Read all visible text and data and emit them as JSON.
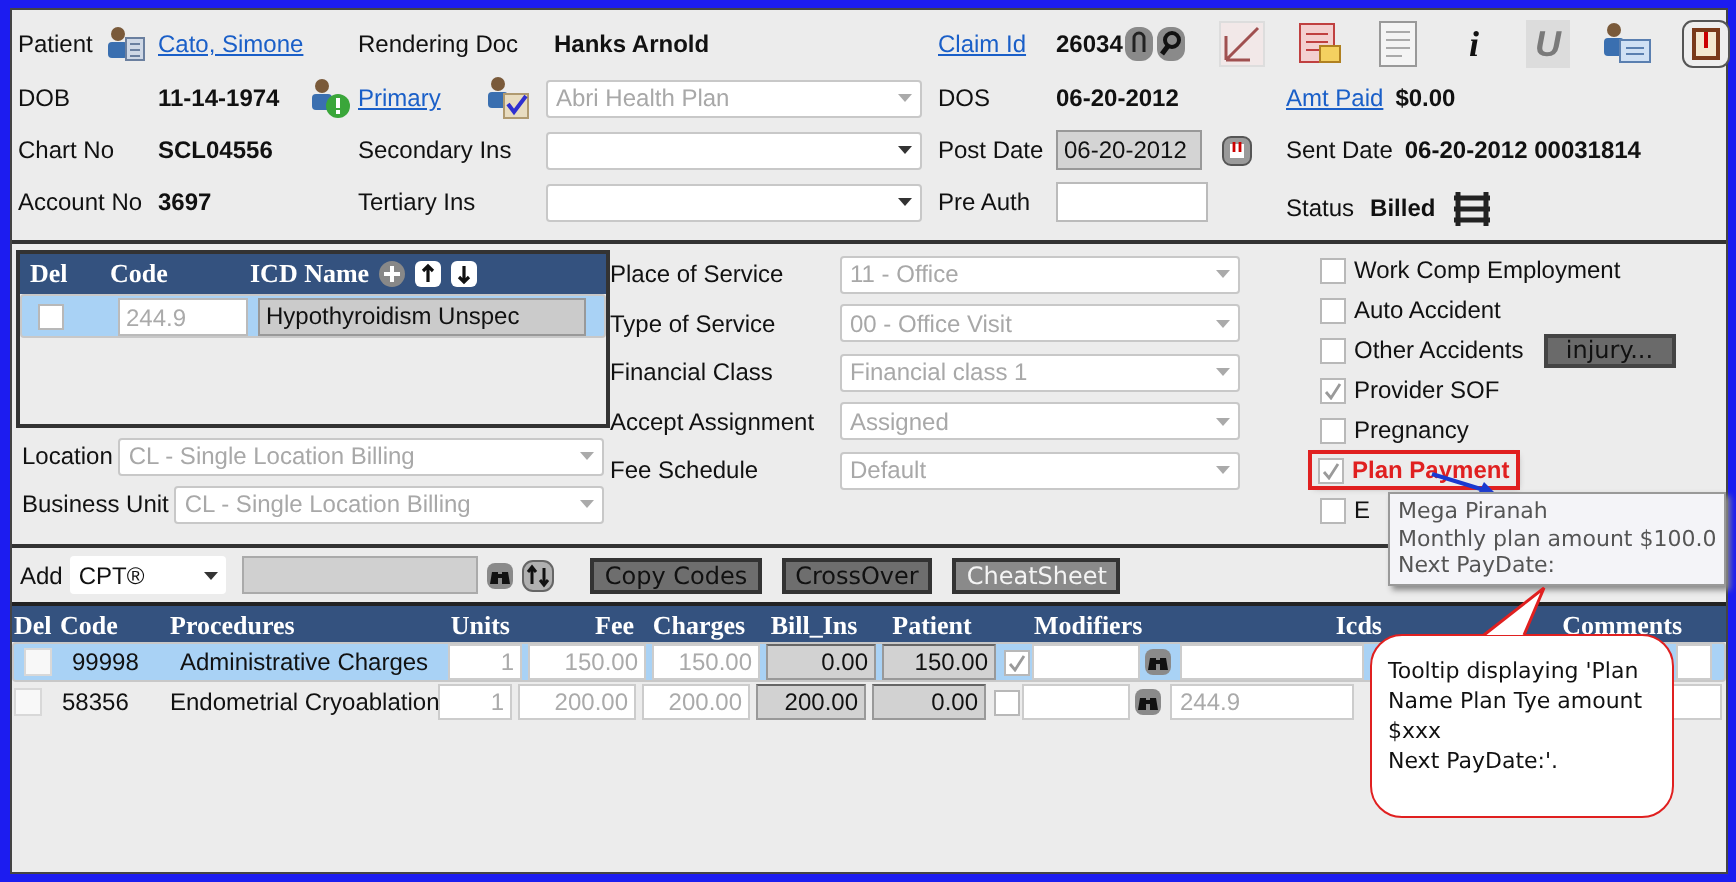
{
  "claim": {
    "patient_label": "Patient",
    "patient": "Cato, Simone",
    "rendering_doc_label": "Rendering Doc",
    "rendering_doc": "Hanks Arnold",
    "claim_id_label": "Claim Id",
    "claim_id": "26034",
    "dob_label": "DOB",
    "dob": "11-14-1974",
    "primary_label": "Primary",
    "primary_ins": "Abri Health Plan",
    "dos_label": "DOS",
    "dos": "06-20-2012",
    "amt_paid_label": "Amt Paid",
    "amt_paid": "$0.00",
    "chart_label": "Chart No",
    "chart_no": "SCL04556",
    "secondary_label": "Secondary Ins",
    "post_date_label": "Post Date",
    "post_date": "06-20-2012",
    "sent_date_label": "Sent Date",
    "sent_date": "06-20-2012 00031814",
    "account_label": "Account No",
    "account_no": "3697",
    "tertiary_label": "Tertiary Ins",
    "pre_auth_label": "Pre Auth",
    "status_label": "Status",
    "status": "Billed"
  },
  "toolbar": [
    {
      "kind": "pen"
    },
    {
      "kind": "forms"
    },
    {
      "kind": "document"
    },
    {
      "kind": "glyph",
      "text": "i",
      "disabled": false
    },
    {
      "kind": "glyph",
      "text": "U",
      "disabled": true
    },
    {
      "kind": "person-card"
    },
    {
      "kind": "book"
    }
  ],
  "diagnosis": {
    "columns": [
      "Del",
      "Code",
      "ICD Name"
    ],
    "rows": [
      {
        "selected": true,
        "checked": false,
        "code": "244.9",
        "name": "Hypothyroidism Unspec"
      }
    ]
  },
  "location": {
    "label": "Location",
    "value": "CL - Single Location Billing"
  },
  "business_unit": {
    "label": "Business Unit",
    "value": "CL - Single Location Billing"
  },
  "service_fields": [
    {
      "label": "Place of Service",
      "value": "11 - Office"
    },
    {
      "label": "Type of Service",
      "value": "00 - Office Visit"
    },
    {
      "label": "Financial Class",
      "value": "Financial class 1"
    },
    {
      "label": "Accept Assignment",
      "value": "Assigned"
    },
    {
      "label": "Fee Schedule",
      "value": "Default"
    }
  ],
  "flags": [
    {
      "label": "Work Comp Employment",
      "checked": false,
      "highlighted": false
    },
    {
      "label": "Auto Accident",
      "checked": false,
      "highlighted": false
    },
    {
      "label": "Other Accidents",
      "checked": false,
      "highlighted": false,
      "button": "injury..."
    },
    {
      "label": "Provider SOF",
      "checked": true,
      "highlighted": false
    },
    {
      "label": "Pregnancy",
      "checked": false,
      "highlighted": false
    },
    {
      "label": "Plan Payment",
      "checked": true,
      "highlighted": true
    },
    {
      "label": "E",
      "checked": false,
      "highlighted": false
    }
  ],
  "add_bar": {
    "label": "Add",
    "code_type": "CPT®",
    "buttons": [
      "Copy Codes",
      "CrossOver",
      "CheatSheet"
    ]
  },
  "procedures": {
    "columns": [
      "Del",
      "Code",
      "Procedures",
      "Units",
      "Fee",
      "Charges",
      "Bill_Ins",
      "Patient",
      "Modifiers",
      "Icds",
      "Comments"
    ],
    "rows": [
      {
        "selected": true,
        "deleted": false,
        "code": "99998",
        "procedure": "Administrative Charges",
        "units": "1",
        "fee": "150.00",
        "charges": "150.00",
        "bill_ins": "0.00",
        "patient": "150.00",
        "patient_checked": true
      },
      {
        "selected": false,
        "deleted": false,
        "code": "58356",
        "procedure": "Endometrial Cryoablation",
        "units": "1",
        "fee": "200.00",
        "charges": "200.00",
        "bill_ins": "200.00",
        "patient": "0.00",
        "patient_checked": false,
        "icds": "244.9"
      }
    ]
  },
  "tooltip": {
    "lines": [
      "Mega Piranah",
      "Monthly plan amount $100.0",
      "Next PayDate:"
    ]
  },
  "callout": {
    "lines": [
      "Tooltip displaying 'Plan Name Plan Tye amount $xxx",
      "Next PayDate:'."
    ]
  }
}
